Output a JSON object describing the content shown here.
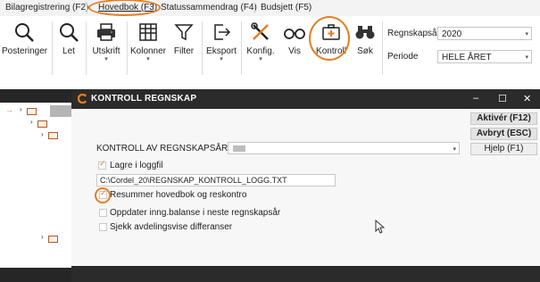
{
  "menu_tabs": [
    {
      "label": "Bilagregistrering (F2)"
    },
    {
      "label": "Hovedbok (F3)"
    },
    {
      "label": "Statussammendrag (F4)"
    },
    {
      "label": "Budsjett (F5)"
    }
  ],
  "ribbon": {
    "buttons": [
      {
        "label": "Posteringer",
        "icon": "magnifier-icon"
      },
      {
        "label": "Let",
        "icon": "magnifier-icon"
      },
      {
        "label": "Utskrift",
        "icon": "printer-icon"
      },
      {
        "label": "Kolonner",
        "icon": "columns-grid-icon"
      },
      {
        "label": "Filter",
        "icon": "funnel-icon"
      },
      {
        "label": "Eksport",
        "icon": "export-icon"
      },
      {
        "label": "Konfig.",
        "icon": "tools-icon"
      },
      {
        "label": "Vis",
        "icon": "glasses-icon"
      },
      {
        "label": "Kontroll",
        "icon": "first-aid-kit-icon"
      },
      {
        "label": "Søk",
        "icon": "binoculars-icon"
      }
    ],
    "regnskapsar_label": "Regnskapsår",
    "regnskapsar_value": "2020",
    "periode_label": "Periode",
    "periode_value": "HELE ÅRET"
  },
  "dialog": {
    "title": "KONTROLL REGNSKAP",
    "window_controls": {
      "minimize": "–",
      "maximize": "☐",
      "close": "✕"
    },
    "section_label": "KONTROLL AV REGNSKAPSÅR",
    "buttons": {
      "activate": "Aktivér (F12)",
      "cancel": "Avbryt (ESC)",
      "help": "Hjelp (F1)"
    },
    "options": [
      {
        "label": "Lagre i loggfil",
        "checked": true
      },
      {
        "label": "Resummer hovedbok og reskontro",
        "checked": true
      },
      {
        "label": "Oppdater inng.balanse i neste regnskapsår",
        "checked": false
      },
      {
        "label": "Sjekk avdelingsvise differanser",
        "checked": false
      }
    ],
    "logfile_path": "C:\\Cordel_20\\REGNSKAP_KONTROLL_LOGG.TXT",
    "check_glyph": "✓"
  },
  "glyphs": {
    "chevron": "›",
    "arrow": "→",
    "dropdown": "▾"
  },
  "colors": {
    "accent": "#e67e22",
    "titlebar": "#2b2b2b"
  }
}
